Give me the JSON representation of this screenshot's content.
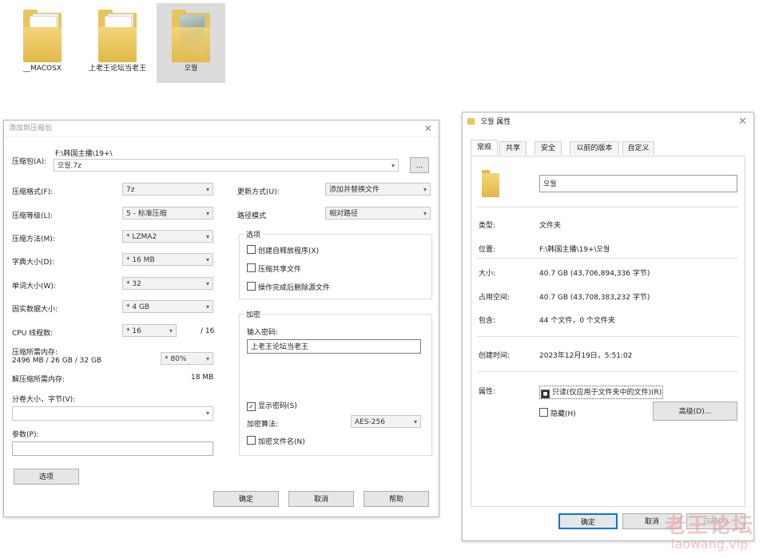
{
  "desktop": {
    "folders": [
      {
        "label": "__MACOSX"
      },
      {
        "label": "上老王论坛当老王"
      },
      {
        "label": "오월"
      }
    ]
  },
  "archive_dialog": {
    "title": "添加到压缩包",
    "archive_label": "压缩包(A):",
    "archive_path": "F:\\韩国主播\\19+\\",
    "archive_name": "오월.7z",
    "browse_label": "...",
    "format_label": "压缩格式(F):",
    "format_value": "7z",
    "level_label": "压缩等级(L):",
    "level_value": "5 - 标准压缩",
    "method_label": "压缩方法(M):",
    "method_value": "* LZMA2",
    "dict_label": "字典大小(D):",
    "dict_value": "* 16 MB",
    "word_label": "单词大小(W):",
    "word_value": "* 32",
    "solid_label": "固实数据大小:",
    "solid_value": "* 4 GB",
    "cpu_label": "CPU 线程数:",
    "cpu_value": "* 16",
    "cpu_total": "/ 16",
    "mem_label": "压缩所需内存:",
    "mem_detail": "2496 MB / 26 GB / 32 GB",
    "mem_value": "* 80%",
    "decomp_label": "解压缩所需内存:",
    "decomp_value": "18 MB",
    "split_label": "分卷大小，字节(V):",
    "split_value": "",
    "params_label": "参数(P):",
    "params_value": "",
    "options_button": "选项",
    "update_label": "更新方式(U):",
    "update_value": "添加并替换文件",
    "pathmode_label": "路径模式",
    "pathmode_value": "相对路径",
    "options_group": "选项",
    "opt_sfx": "创建自释放程序(X)",
    "opt_shared": "压缩共享文件",
    "opt_delete": "操作完成后删除源文件",
    "encrypt_group": "加密",
    "password_label": "输入密码:",
    "password_value": "上老王论坛当老王",
    "show_password": "显示密码(S)",
    "show_password_checked": true,
    "enc_method_label": "加密算法:",
    "enc_method_value": "AES-256",
    "encrypt_names": "加密文件名(N)",
    "ok": "确定",
    "cancel": "取消",
    "help": "帮助"
  },
  "props_dialog": {
    "title": "오월 属性",
    "tabs": [
      "常规",
      "共享",
      "安全",
      "以前的版本",
      "自定义"
    ],
    "active_tab": 0,
    "name_value": "오월",
    "type_label": "类型:",
    "type_value": "文件夹",
    "location_label": "位置:",
    "location_value": "F:\\韩国主播\\19+\\오월",
    "size_label": "大小:",
    "size_value": "40.7 GB (43,706,894,336 字节)",
    "disk_label": "占用空间:",
    "disk_value": "40.7 GB (43,708,383,232 字节)",
    "contains_label": "包含:",
    "contains_value": "44 个文件，0 个文件夹",
    "created_label": "创建时间:",
    "created_value": "2023年12月19日，5:51:02",
    "attr_label": "属性:",
    "readonly_label": "只读(仅应用于文件夹中的文件)(R)",
    "hidden_label": "隐藏(H)",
    "advanced_button": "高级(D)...",
    "ok": "确定",
    "cancel": "取消",
    "apply": "应用(A)"
  },
  "watermark": {
    "line1": "老王论坛",
    "line2": "laowang.vip"
  }
}
